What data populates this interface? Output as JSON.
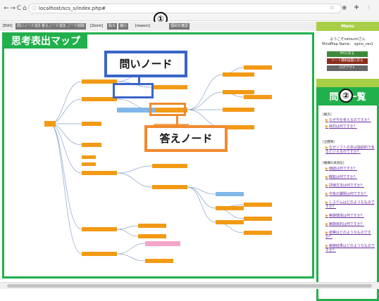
{
  "browser": {
    "back": "←",
    "forward": "→",
    "reload": "C",
    "home": "⌂",
    "lock": "ⓘ",
    "url": "localhost/scs_s/index.php#",
    "icons": "☆ ◉ ✚ ⋮"
  },
  "markers": {
    "one": "①",
    "two": "②"
  },
  "toolbar": {
    "edit": "[Edit]",
    "btn_question_node": "問いノード追加",
    "btn_answer_node": "答えノード追加",
    "btn_node_delete": "ノード削除",
    "zoom": "[Zoom]",
    "btn_zoom_in": "拡大",
    "btn_zoom_out": "縮小",
    "reason": "[reason]",
    "btn_last": "理由を確認"
  },
  "map": {
    "title": "思考表出マップ"
  },
  "callouts": {
    "question_node": "問いノード",
    "answer_node": "答えノード"
  },
  "sidebar": {
    "menu": "Menu",
    "greeting": "ようこそnatsumiさん",
    "mindmap": "MindMap Name： sgino_ver1",
    "buttons": [
      "MYに戻る",
      "シート選択画面に戻る",
      "ログアウト"
    ],
    "button_colors": [
      "#3c8a3c",
      "#8b2e1c",
      "#666666"
    ]
  },
  "questions": {
    "title": "問い一覧",
    "sections": [
      {
        "label": "[概念]",
        "items": [
          "なぜ今を考えるのですか？",
          "目的は何ですか？"
        ]
      },
      {
        "label": "[全體像]",
        "items": [
          "なぜソフトの本は独創的であるといえるのですか？"
        ]
      },
      {
        "label": "[機構の具現化]",
        "items": [
          "価値は何ですか？",
          "機能は何ですか？",
          "評価方法は何ですか？",
          "今後の課題は何ですか？",
          "システムはどのようなものですか？",
          "実験環境は何ですか？",
          "実験目的は何ですか？",
          "考察はどのようなものですか？",
          "実験結果はどのようなものですか？"
        ]
      }
    ]
  }
}
